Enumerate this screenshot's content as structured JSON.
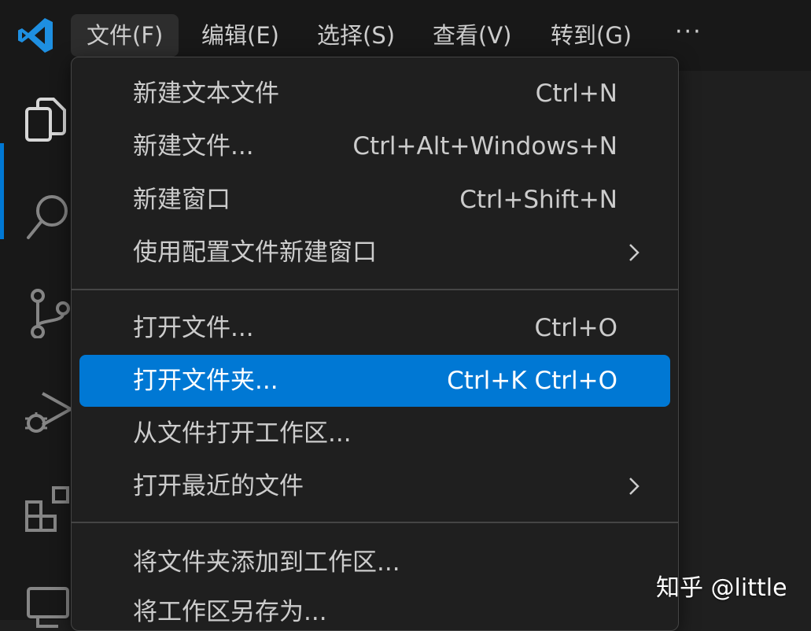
{
  "menubar": {
    "items": [
      {
        "label": "文件(F)"
      },
      {
        "label": "编辑(E)"
      },
      {
        "label": "选择(S)"
      },
      {
        "label": "查看(V)"
      },
      {
        "label": "转到(G)"
      }
    ],
    "more": "···"
  },
  "file_menu": {
    "items": [
      {
        "label": "新建文本文件",
        "shortcut": "Ctrl+N"
      },
      {
        "label": "新建文件...",
        "shortcut": "Ctrl+Alt+Windows+N"
      },
      {
        "label": "新建窗口",
        "shortcut": "Ctrl+Shift+N"
      },
      {
        "label": "使用配置文件新建窗口",
        "shortcut": ""
      },
      {
        "label": "打开文件...",
        "shortcut": "Ctrl+O"
      },
      {
        "label": "打开文件夹...",
        "shortcut": "Ctrl+K Ctrl+O"
      },
      {
        "label": "从文件打开工作区...",
        "shortcut": ""
      },
      {
        "label": "打开最近的文件",
        "shortcut": ""
      },
      {
        "label": "将文件夹添加到工作区...",
        "shortcut": ""
      },
      {
        "label": "将工作区另存为...",
        "shortcut": ""
      }
    ]
  },
  "watermark": "知乎 @little",
  "colors": {
    "accent": "#0078d4",
    "menu_bg": "#1f1f1f",
    "titlebar_bg": "#181818",
    "text": "#cccccc"
  }
}
